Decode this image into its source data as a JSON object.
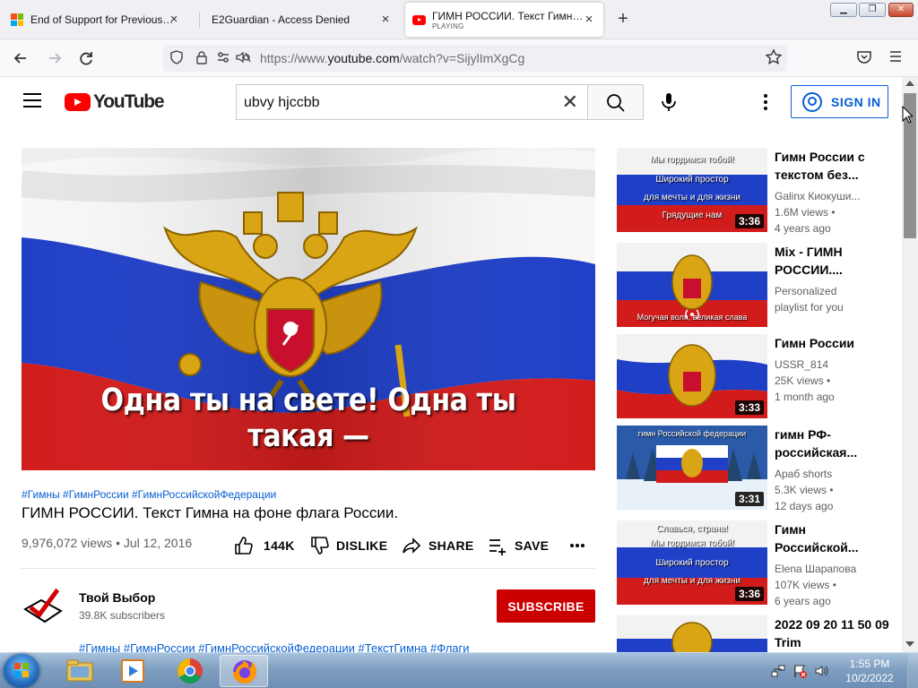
{
  "browser": {
    "tabs": [
      {
        "title": "End of Support for Previous Versi",
        "favicon": "microsoft-icon"
      },
      {
        "title": "E2Guardian - Access Denied",
        "favicon": "none"
      },
      {
        "title": "ГИМН РОССИИ. Текст Гимна н",
        "subtitle": "PLAYING",
        "favicon": "youtube-icon",
        "active": true
      }
    ],
    "new_tab": "+",
    "url_prefix": "https://www.",
    "url_domain": "youtube.com",
    "url_path": "/watch?v=SijylImXgCg"
  },
  "youtube": {
    "logo_text": "YouTube",
    "search_query": "ubvy hjccbb",
    "sign_in": "SIGN IN"
  },
  "video": {
    "caption": "Одна ты на свете! Одна ты такая —",
    "tags": "#Гимны #ГимнРоссии #ГимнРоссийскойФедерации",
    "title": "ГИМН РОССИИ. Текст Гимна на фоне флага России.",
    "views": "9,976,072 views",
    "date": "Jul 12, 2016",
    "likes": "144K",
    "dislike": "DISLIKE",
    "share": "SHARE",
    "save": "SAVE",
    "channel": "Твой Выбор",
    "subscribers": "39.8K subscribers",
    "subscribe": "SUBSCRIBE",
    "desc_tags": "#Гимны #ГимнРоссии #ГимнРоссийскойФедерации #ТекстГимна #Флаги"
  },
  "recommendations": [
    {
      "title": "Гимн России с текстом без...",
      "channel": "Galinx Киокуши...",
      "views": "1.6M views •",
      "age": "4 years ago",
      "duration": "3:36",
      "thumb_lines": [
        "Мы гордимся тобой!",
        "Широкий простор",
        "для мечты и для жизни",
        "Грядущие нам"
      ]
    },
    {
      "title": "Mix - ГИМН РОССИИ....",
      "channel": "Personalized",
      "views": "playlist for you",
      "age": "",
      "duration": "",
      "thumb_lines": [
        "Могучая воля, великая слава"
      ]
    },
    {
      "title": "Гимн России",
      "channel": "USSR_814",
      "views": "25K views •",
      "age": "1 month ago",
      "duration": "3:33",
      "thumb_lines": []
    },
    {
      "title": "гимн РФ- российская...",
      "channel": "Араб shorts",
      "views": "5.3K views •",
      "age": "12 days ago",
      "duration": "3:31",
      "thumb_lines": [
        "гимн Российской федерации"
      ]
    },
    {
      "title": "Гимн Российской...",
      "channel": "Elena Шарапова",
      "views": "107K views •",
      "age": "6 years ago",
      "duration": "3:36",
      "thumb_lines": [
        "Славься, страна!",
        "Мы гордимся тобой!",
        "Широкий простор",
        "для мечты и для жизни"
      ]
    },
    {
      "title": "2022 09 20 11 50 09 Trim",
      "channel": "",
      "views": "",
      "age": "",
      "duration": "",
      "thumb_lines": []
    }
  ],
  "taskbar": {
    "time": "1:55 PM",
    "date": "10/2/2022"
  },
  "colors": {
    "youtube_red": "#ff0000",
    "subscribe_red": "#cc0000",
    "link_blue": "#065fd4",
    "flag_white": "#f4f4f4",
    "flag_blue": "#1f3fc7",
    "flag_red": "#d21c1c"
  }
}
